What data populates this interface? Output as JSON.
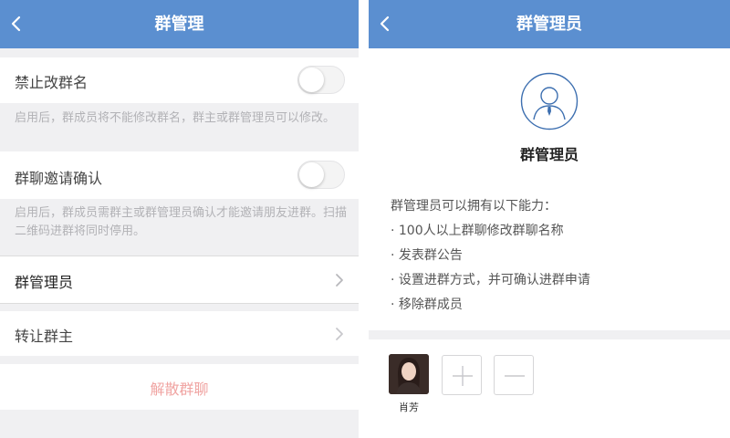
{
  "left_screen": {
    "title": "群管理",
    "no_rename": {
      "label": "禁止改群名",
      "enabled": false,
      "hint": "启用后，群成员将不能修改群名，群主或群管理员可以修改。"
    },
    "invite_confirm": {
      "label": "群聊邀请确认",
      "enabled": false,
      "hint": "启用后，群成员需群主或群管理员确认才能邀请朋友进群。扫描二维码进群将同时停用。"
    },
    "admin_row": {
      "label": "群管理员"
    },
    "transfer_row": {
      "label": "转让群主"
    },
    "dissolve_label": "解散群聊"
  },
  "right_screen": {
    "title": "群管理员",
    "heading": "群管理员",
    "capabilities_intro": "群管理员可以拥有以下能力：",
    "capabilities": [
      "· 100人以上群聊修改群聊名称",
      "· 发表群公告",
      "· 设置进群方式，并可确认进群申请",
      "· 移除群成员"
    ],
    "members": [
      {
        "name": "肖芳"
      }
    ],
    "add_label": "+",
    "remove_label": "−"
  },
  "colors": {
    "nav_bar": "#5b8fd0",
    "dissolve_text": "#f0a4a2",
    "page_background": "#f0f0f2",
    "avatar_outline": "#3d6fb0"
  },
  "icons": {
    "back": "chevron-left-icon",
    "row_arrow": "chevron-right-icon",
    "admin_avatar": "user-tie-icon",
    "add": "plus-icon",
    "remove": "minus-icon"
  }
}
